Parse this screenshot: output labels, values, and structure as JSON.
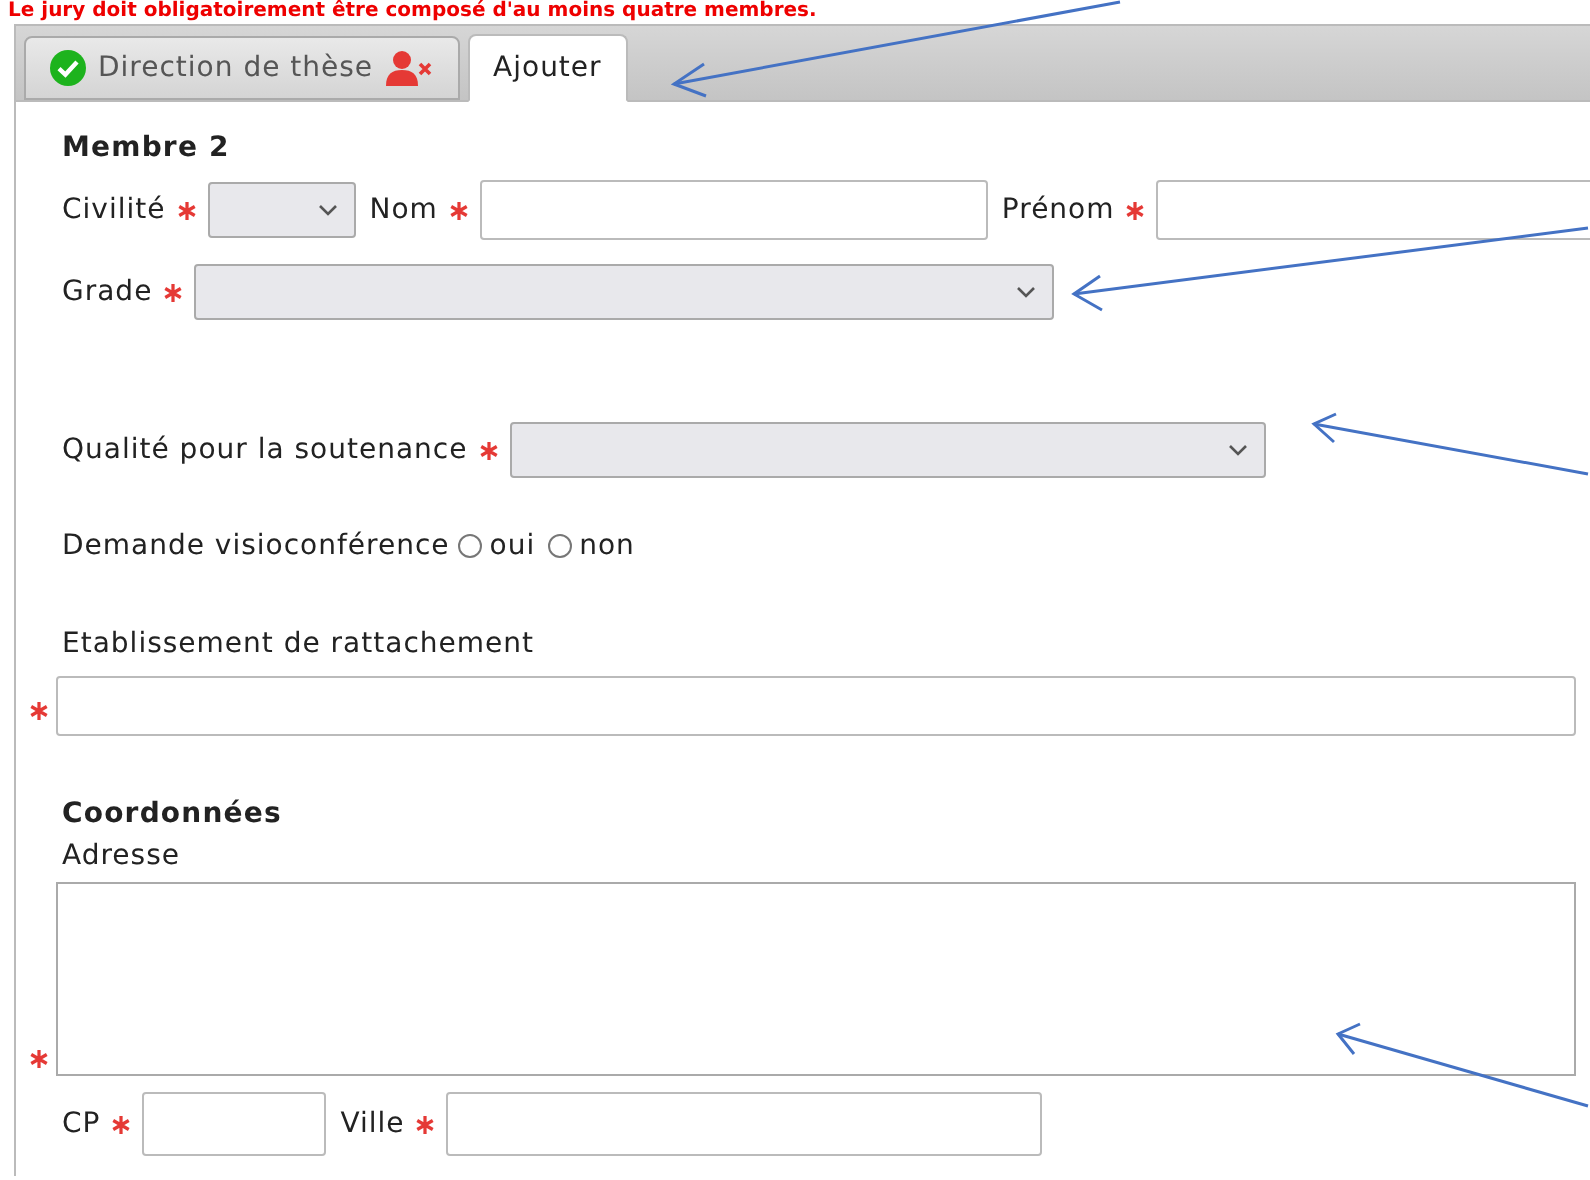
{
  "notice": "Le jury doit obligatoirement être composé d'au moins quatre membres.",
  "tabs": [
    {
      "label": "Direction de thèse",
      "selected": false,
      "complete": true,
      "removable": true
    },
    {
      "label": "Ajouter",
      "selected": true,
      "complete": false,
      "removable": false
    }
  ],
  "section_title": "Membre 2",
  "identity": [
    {
      "label": "Civilité",
      "required": true,
      "kind": "select"
    },
    {
      "label": "Nom",
      "required": true,
      "kind": "input"
    },
    {
      "label": "Prénom",
      "required": true,
      "kind": "input"
    }
  ],
  "grade": {
    "label": "Grade",
    "required": true
  },
  "qualite": {
    "label": "Qualité pour la soutenance",
    "required": true
  },
  "visio": {
    "label": "Demande visioconférence",
    "options": [
      {
        "label": "oui",
        "selected": false
      },
      {
        "label": "non",
        "selected": false
      }
    ]
  },
  "etablissement": {
    "label": "Etablissement de rattachement",
    "required": true
  },
  "coordonnees_title": "Coordonnées",
  "adresse": {
    "label": "Adresse",
    "required": true
  },
  "city_row": [
    {
      "label": "CP",
      "required": true
    },
    {
      "label": "Ville",
      "required": true
    }
  ]
}
